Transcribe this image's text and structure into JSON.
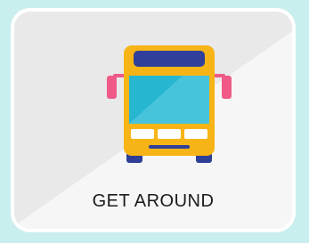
{
  "card": {
    "label": "GET AROUND",
    "icon": "bus-icon"
  },
  "colors": {
    "background": "#c9eeee",
    "card": "#eeeeee",
    "bus_body": "#f6b416",
    "bus_window": "#27b6d0",
    "bus_window_light": "#47c4dc",
    "mirror": "#ef5a86",
    "sign": "#2f3f9a",
    "wheel": "#2d3f96"
  }
}
